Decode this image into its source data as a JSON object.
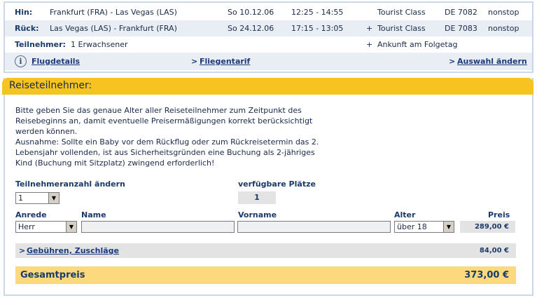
{
  "flight": {
    "outbound": {
      "label": "Hin:",
      "route": "Frankfurt (FRA) - Las Vegas (LAS)",
      "date": "So 10.12.06",
      "time": "12:25 - 14:55",
      "class": "Tourist Class",
      "flight_no": "DE 7082",
      "stops": "nonstop"
    },
    "return": {
      "label": "Rück:",
      "route": "Las Vegas (LAS) - Frankfurt (FRA)",
      "date": "So 24.12.06",
      "time": "17:15 - 13:05",
      "plus": "+",
      "class": "Tourist Class",
      "flight_no": "DE 7083",
      "stops": "nonstop"
    },
    "participants": {
      "label": "Teilnehmer:",
      "value": "1 Erwachsener",
      "plus": "+",
      "note": "Ankunft am Folgetag"
    },
    "links": {
      "info_glyph": "i",
      "details": "Flugdetails",
      "fare": "Fliegentarif",
      "change": "Auswahl ändern",
      "chevron": ">"
    }
  },
  "section": {
    "title": "Reiseteilnehmer:",
    "intro": [
      "Bitte geben Sie das genaue Alter aller Reiseteilnehmer zum Zeitpunkt des",
      "Reisebeginns an, damit eventuelle Preisermäßigungen korrekt berücksichtigt",
      "werden können.",
      "Ausnahme: Sollte ein Baby vor dem Rückflug oder zum Rückreisetermin das 2.",
      "Lebensjahr vollenden, ist aus Sicherheitsgründen eine Buchung als 2-jähriges",
      "Kind (Buchung mit Sitzplatz) zwingend erforderlich!"
    ]
  },
  "form": {
    "count_label": "Teilnehmeranzahl ändern",
    "count_value": "1",
    "available_label": "verfügbare Plätze",
    "available_value": "1",
    "col_salutation": "Anrede",
    "col_name": "Name",
    "col_firstname": "Vorname",
    "col_age": "Alter",
    "col_price": "Preis",
    "salutation_value": "Herr",
    "age_value": "über 18",
    "price_value": "289,00 €",
    "dropdown_glyph": "▼"
  },
  "fees": {
    "chevron": ">",
    "label": "Gebühren, Zuschläge",
    "amount": "84,00 €"
  },
  "total": {
    "label": "Gesamtpreis",
    "amount": "373,00 €"
  },
  "colors": {
    "accent": "#f6c320",
    "total_bg": "#fbd97c",
    "row_bg": "#e9eef4",
    "border": "#c9d7e6",
    "text": "#1a3a6a"
  }
}
